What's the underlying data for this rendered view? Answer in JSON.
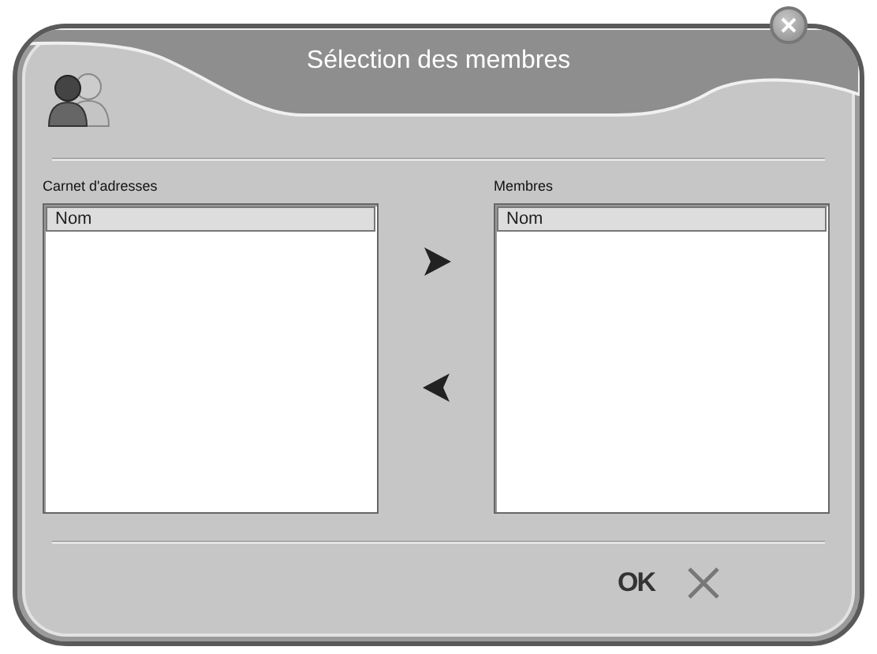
{
  "window": {
    "title": "Sélection des membres"
  },
  "panels": [
    {
      "label": "Carnet d'adresses",
      "columns": [
        "Nom"
      ]
    },
    {
      "label": "Membres",
      "columns": [
        "Nom"
      ]
    }
  ],
  "footer": {
    "ok_label": "OK"
  }
}
